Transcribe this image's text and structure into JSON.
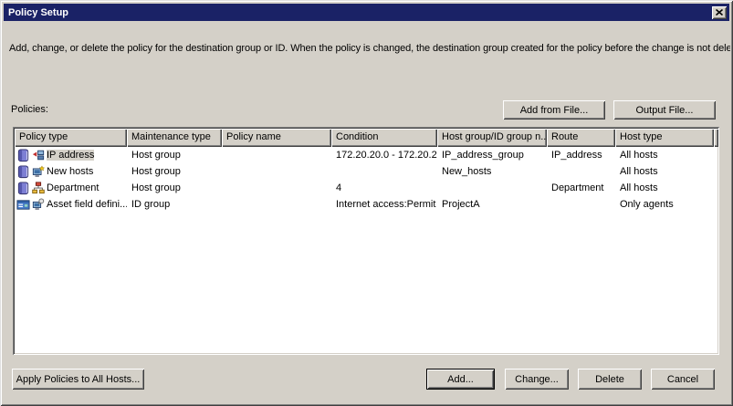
{
  "window": {
    "title": "Policy Setup"
  },
  "instructions": "Add, change, or delete the policy for the destination group or ID. When the policy is changed, the destination group created for the policy before the change is not deleted.",
  "policies_label": "Policies:",
  "toolbar": {
    "add_from_file": "Add from File...",
    "output_file": "Output File..."
  },
  "table": {
    "columns": [
      "Policy type",
      "Maintenance type",
      "Policy name",
      "Condition",
      "Host group/ID group n...",
      "Route",
      "Host type"
    ],
    "rows": [
      {
        "selected": true,
        "icons": [
          "notebook-icon",
          "ip-network-icon"
        ],
        "policy_type": "IP address",
        "maintenance_type": "Host group",
        "policy_name": "",
        "condition": "172.20.20.0 - 172.20.2...",
        "host_group": "IP_address_group",
        "route": "IP_address",
        "host_type": "All hosts"
      },
      {
        "selected": false,
        "icons": [
          "notebook-icon",
          "new-host-computer-icon"
        ],
        "policy_type": "New hosts",
        "maintenance_type": "Host group",
        "policy_name": "",
        "condition": "",
        "host_group": "New_hosts",
        "route": "",
        "host_type": "All hosts"
      },
      {
        "selected": false,
        "icons": [
          "notebook-icon",
          "department-tree-icon"
        ],
        "policy_type": "Department",
        "maintenance_type": "Host group",
        "policy_name": "",
        "condition": "4",
        "host_group": "",
        "route": "Department",
        "host_type": "All hosts"
      },
      {
        "selected": false,
        "icons": [
          "asset-list-icon",
          "asset-search-computer-icon"
        ],
        "policy_type": "Asset field defini...",
        "maintenance_type": "ID group",
        "policy_name": "",
        "condition": "Internet access:Permit",
        "host_group": "ProjectA",
        "route": "",
        "host_type": "Only agents"
      }
    ]
  },
  "footer": {
    "apply_all": "Apply Policies to All Hosts...",
    "add": "Add...",
    "change": "Change...",
    "delete": "Delete",
    "cancel": "Cancel"
  },
  "colors": {
    "titlebar": "#1a2266",
    "dialog_face": "#d4d0c8",
    "table_background": "#ffffff",
    "selection_background": "#d5d1c9"
  }
}
